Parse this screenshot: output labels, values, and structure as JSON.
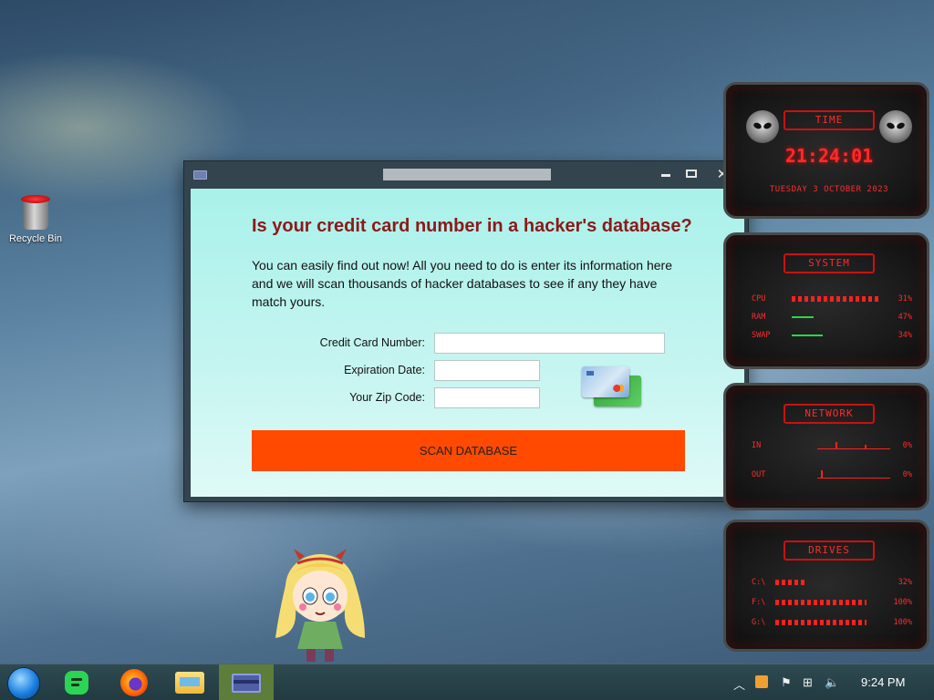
{
  "desktop": {
    "recycle_bin_label": "Recycle Bin"
  },
  "dialog": {
    "headline": "Is your credit card number in a hacker's database?",
    "intro": "You can easily find out now! All you need to do is enter its information here and we will scan thousands of hacker databases to see if any they have match yours.",
    "fields": {
      "card_number_label": "Credit Card Number:",
      "card_number_value": "",
      "expiration_label": "Expiration Date:",
      "expiration_value": "",
      "zip_label": "Your Zip Code:",
      "zip_value": ""
    },
    "scan_button": "SCAN DATABASE",
    "colors": {
      "headline": "#8b1a1a",
      "button": "#ff4a00",
      "background": "#a9f1ea"
    }
  },
  "gadget": {
    "time_badge": "TIME",
    "time": "21:24:01",
    "date": "TUESDAY 3 OCTOBER 2023",
    "system_badge": "SYSTEM",
    "system": [
      {
        "name": "CPU",
        "value": "31%",
        "level": 0.31
      },
      {
        "name": "RAM",
        "value": "47%",
        "level": 0.47
      },
      {
        "name": "SWAP",
        "value": "34%",
        "level": 0.34
      }
    ],
    "network_badge": "NETWORK",
    "network": [
      {
        "name": "IN",
        "value": "0%"
      },
      {
        "name": "OUT",
        "value": "0%"
      }
    ],
    "drives_badge": "DRIVES",
    "drives": [
      {
        "name": "C:\\",
        "value": "32%",
        "level": 0.32
      },
      {
        "name": "F:\\",
        "value": "100%",
        "level": 1.0
      },
      {
        "name": "G:\\",
        "value": "100%",
        "level": 1.0
      }
    ],
    "accent": "#ff2b2b"
  },
  "taskbar": {
    "clock": "9:24 PM",
    "items": [
      "start-orb",
      "notes-icon",
      "firefox-icon",
      "file-explorer-icon",
      "credit-card-app-icon"
    ],
    "active_item": "credit-card-app-icon",
    "tray_icons": [
      "chevron-up-icon",
      "update-icon",
      "flag-icon",
      "network-icon",
      "volume-icon"
    ]
  }
}
